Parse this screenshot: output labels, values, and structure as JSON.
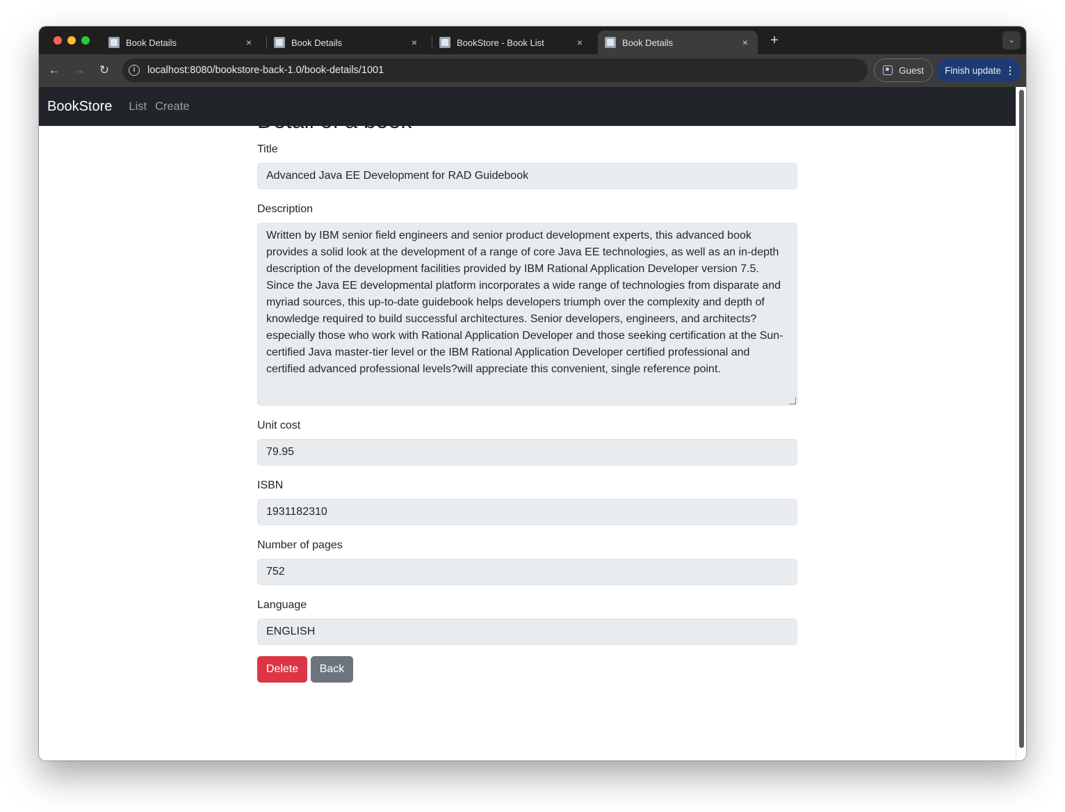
{
  "browser": {
    "tabs": [
      {
        "title": "Book Details",
        "active": false
      },
      {
        "title": "Book Details",
        "active": false
      },
      {
        "title": "BookStore - Book List",
        "active": false
      },
      {
        "title": "Book Details",
        "active": true
      }
    ],
    "close_glyph": "×",
    "new_tab_glyph": "+",
    "url": "localhost:8080/bookstore-back-1.0/book-details/1001",
    "profile_label": "Guest",
    "update_label": "Finish update"
  },
  "navbar": {
    "brand": "BookStore",
    "links": [
      "List",
      "Create"
    ],
    "background": "#212529"
  },
  "page": {
    "heading": "Detail of a book",
    "fields": {
      "title": {
        "label": "Title",
        "value": "Advanced Java EE Development for RAD Guidebook"
      },
      "description": {
        "label": "Description",
        "value": "Written by IBM senior field engineers and senior product development experts, this advanced book provides a solid look at the development of a range of core Java EE technologies, as well as an in-depth description of the development facilities provided by IBM Rational Application Developer version 7.5. Since the Java EE developmental platform incorporates a wide range of technologies from disparate and myriad sources, this up-to-date guidebook helps developers triumph over the complexity and depth of knowledge required to build successful architectures. Senior developers, engineers, and architects?especially those who work with Rational Application Developer and those seeking certification at the Sun-certified Java master-tier level or the IBM Rational Application Developer certified professional and certified advanced professional levels?will appreciate this convenient, single reference point."
      },
      "unit_cost": {
        "label": "Unit cost",
        "value": "79.95"
      },
      "isbn": {
        "label": "ISBN",
        "value": "1931182310"
      },
      "pages": {
        "label": "Number of pages",
        "value": "752"
      },
      "language": {
        "label": "Language",
        "value": "ENGLISH"
      }
    },
    "buttons": {
      "delete": "Delete",
      "back": "Back"
    },
    "colors": {
      "danger": "#dc3545",
      "secondary": "#6c757d",
      "readonly_field": "#e9ecef"
    }
  }
}
